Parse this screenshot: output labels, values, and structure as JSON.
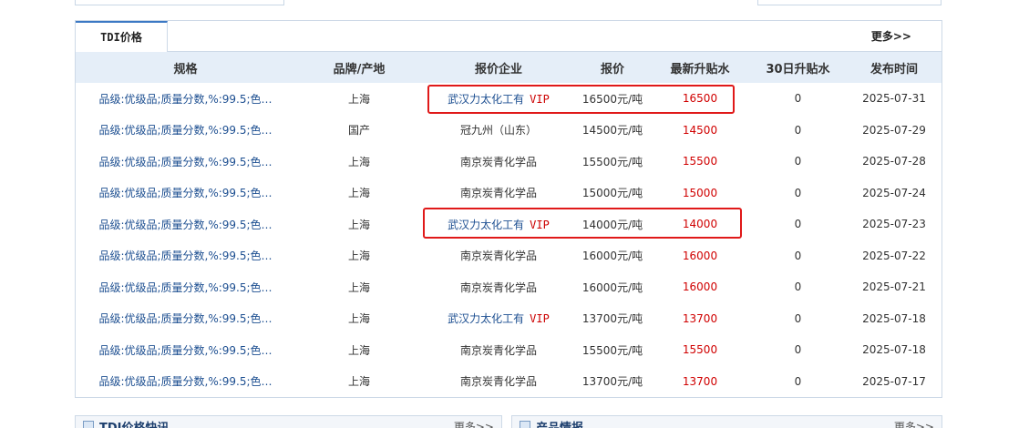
{
  "tab": {
    "label": "TDI价格",
    "more": "更多>>"
  },
  "table": {
    "headers": [
      "规格",
      "品牌/产地",
      "报价企业",
      "报价",
      "最新升贴水",
      "30日升贴水",
      "发布时间"
    ],
    "vip_label": "VIP",
    "rows": [
      {
        "spec": "品级:优级品;质量分数,%:99.5;色…",
        "origin": "上海",
        "company": "武汉力太化工有",
        "vip": true,
        "price": "16500元/吨",
        "premium": "16500",
        "premium30": "0",
        "date": "2025-07-31"
      },
      {
        "spec": "品级:优级品;质量分数,%:99.5;色…",
        "origin": "国产",
        "company": "冠九州（山东）",
        "vip": false,
        "price": "14500元/吨",
        "premium": "14500",
        "premium30": "0",
        "date": "2025-07-29"
      },
      {
        "spec": "品级:优级品;质量分数,%:99.5;色…",
        "origin": "上海",
        "company": "南京炭青化学品",
        "vip": false,
        "price": "15500元/吨",
        "premium": "15500",
        "premium30": "0",
        "date": "2025-07-28"
      },
      {
        "spec": "品级:优级品;质量分数,%:99.5;色…",
        "origin": "上海",
        "company": "南京炭青化学品",
        "vip": false,
        "price": "15000元/吨",
        "premium": "15000",
        "premium30": "0",
        "date": "2025-07-24"
      },
      {
        "spec": "品级:优级品;质量分数,%:99.5;色…",
        "origin": "上海",
        "company": "武汉力太化工有",
        "vip": true,
        "price": "14000元/吨",
        "premium": "14000",
        "premium30": "0",
        "date": "2025-07-23"
      },
      {
        "spec": "品级:优级品;质量分数,%:99.5;色…",
        "origin": "上海",
        "company": "南京炭青化学品",
        "vip": false,
        "price": "16000元/吨",
        "premium": "16000",
        "premium30": "0",
        "date": "2025-07-22"
      },
      {
        "spec": "品级:优级品;质量分数,%:99.5;色…",
        "origin": "上海",
        "company": "南京炭青化学品",
        "vip": false,
        "price": "16000元/吨",
        "premium": "16000",
        "premium30": "0",
        "date": "2025-07-21"
      },
      {
        "spec": "品级:优级品;质量分数,%:99.5;色…",
        "origin": "上海",
        "company": "武汉力太化工有",
        "vip": true,
        "price": "13700元/吨",
        "premium": "13700",
        "premium30": "0",
        "date": "2025-07-18"
      },
      {
        "spec": "品级:优级品;质量分数,%:99.5;色…",
        "origin": "上海",
        "company": "南京炭青化学品",
        "vip": false,
        "price": "15500元/吨",
        "premium": "15500",
        "premium30": "0",
        "date": "2025-07-18"
      },
      {
        "spec": "品级:优级品;质量分数,%:99.5;色…",
        "origin": "上海",
        "company": "南京炭青化学品",
        "vip": false,
        "price": "13700元/吨",
        "premium": "13700",
        "premium30": "0",
        "date": "2025-07-17"
      }
    ]
  },
  "bottom": {
    "left": {
      "title": "TDI价格快讯",
      "more": "更多>>"
    },
    "right": {
      "title": "产品情报",
      "more": "更多>>"
    }
  },
  "colors": {
    "accent": "#3b78c4",
    "header_bg": "#e5eef8",
    "premium": "#d00000",
    "highlight": "#e01919"
  }
}
